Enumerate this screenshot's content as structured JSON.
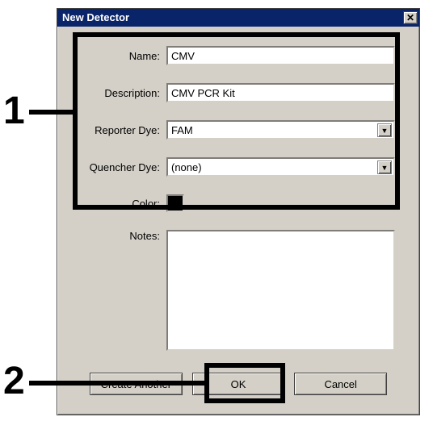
{
  "dialog": {
    "title": "New Detector",
    "closeGlyph": "✕"
  },
  "labels": {
    "name": "Name:",
    "description": "Description:",
    "reporter": "Reporter Dye:",
    "quencher": "Quencher Dye:",
    "color": "Color:",
    "notes": "Notes:"
  },
  "values": {
    "name": "CMV",
    "description": "CMV PCR Kit",
    "reporter": "FAM",
    "quencher": "(none)",
    "colorHex": "#000000",
    "notes": ""
  },
  "buttons": {
    "createAnother": "Create Another",
    "ok": "OK",
    "cancel": "Cancel"
  },
  "annotations": {
    "n1": "1",
    "n2": "2"
  }
}
